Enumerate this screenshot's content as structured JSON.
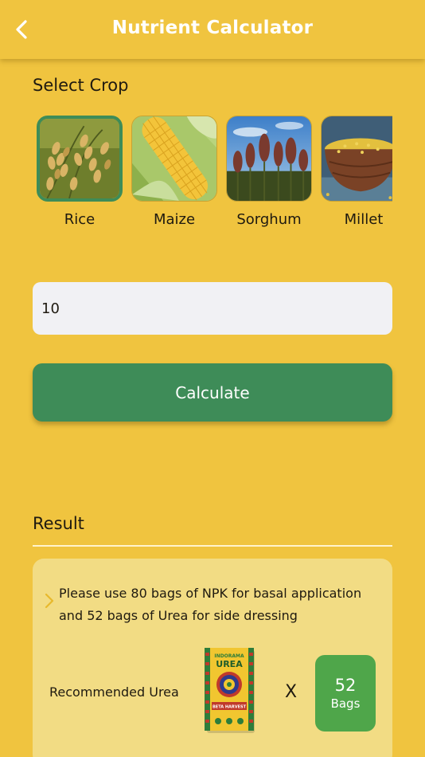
{
  "header": {
    "title": "Nutrient Calculator",
    "back_icon": "chevron-left-icon"
  },
  "crop_section": {
    "label": "Select Crop",
    "selected": "Rice",
    "crops": [
      {
        "name": "Rice",
        "image": "rice-photo"
      },
      {
        "name": "Maize",
        "image": "maize-photo"
      },
      {
        "name": "Sorghum",
        "image": "sorghum-photo"
      },
      {
        "name": "Millet",
        "image": "millet-photo"
      }
    ]
  },
  "amount_input": {
    "value": "10"
  },
  "calculate_button": {
    "label": "Calculate"
  },
  "result": {
    "heading": "Result",
    "message": "Please use 80 bags of NPK for basal application and 52 bags of Urea for side dressing",
    "recommended_label": "Recommended Urea",
    "multiply_symbol": "X",
    "bags_count": "52",
    "bags_unit": "Bags",
    "product": {
      "brand": "INDORAMA",
      "name": "UREA",
      "sub": "BETA HARVEST"
    }
  },
  "colors": {
    "background": "#F0C43F",
    "primary_green": "#3E8C58",
    "badge_green": "#4FA64A",
    "card": "#F2DC84",
    "input": "#F1F1F4"
  }
}
